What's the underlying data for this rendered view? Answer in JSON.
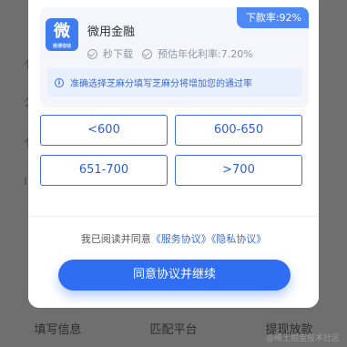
{
  "background": {
    "bottom_tabs": [
      "填写信息",
      "匹配平台",
      "提现放款"
    ],
    "watermark": "@稀土掘金技术社区"
  },
  "product": {
    "badge": "下款率:92%",
    "logo_char": "微",
    "logo_sub": "微博借钱",
    "name": "微用金融",
    "meta": [
      "秒下载",
      "预估年化利率:7.20%"
    ],
    "tip": "准确选择芝麻分填写芝麻分将增加您的通过率"
  },
  "options": [
    "<600",
    "600-650",
    "651-700",
    ">700"
  ],
  "agreement": {
    "prefix": "我已阅读并同意",
    "service": "《服务协议》",
    "privacy": "《隐私协议》"
  },
  "submit_label": "同意协议并继续",
  "colors": {
    "primary": "#2f6df2",
    "badge": "#4f89f5",
    "tip_bg": "#e8effd"
  }
}
